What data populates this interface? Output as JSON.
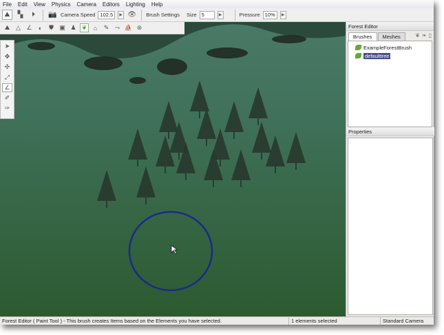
{
  "menu": [
    "File",
    "Edit",
    "View",
    "Physics",
    "Camera",
    "Editors",
    "Lighting",
    "Help"
  ],
  "toolbar": {
    "camera_speed_label": "Camera Speed",
    "camera_speed": "102.5",
    "brush_settings_label": "Brush Settings",
    "size_label": "Size",
    "size": "5",
    "pressure_label": "Pressure",
    "pressure": "10%"
  },
  "forest_editor": {
    "title": "Forest Editor",
    "tabs": [
      "Brushes",
      "Meshes"
    ],
    "tree": [
      "ExampleForestBrush",
      "defaulttree"
    ],
    "properties_title": "Properties"
  },
  "status": {
    "message": "Forest Editor ( Paint Tool ) - This brush creates Items based on the Elements you have selected.",
    "selection": "1 elements selected",
    "camera": "Standard Camera"
  },
  "colors": {
    "brush_circle": "#1a2a8a",
    "selection": "#4a4f8f"
  }
}
